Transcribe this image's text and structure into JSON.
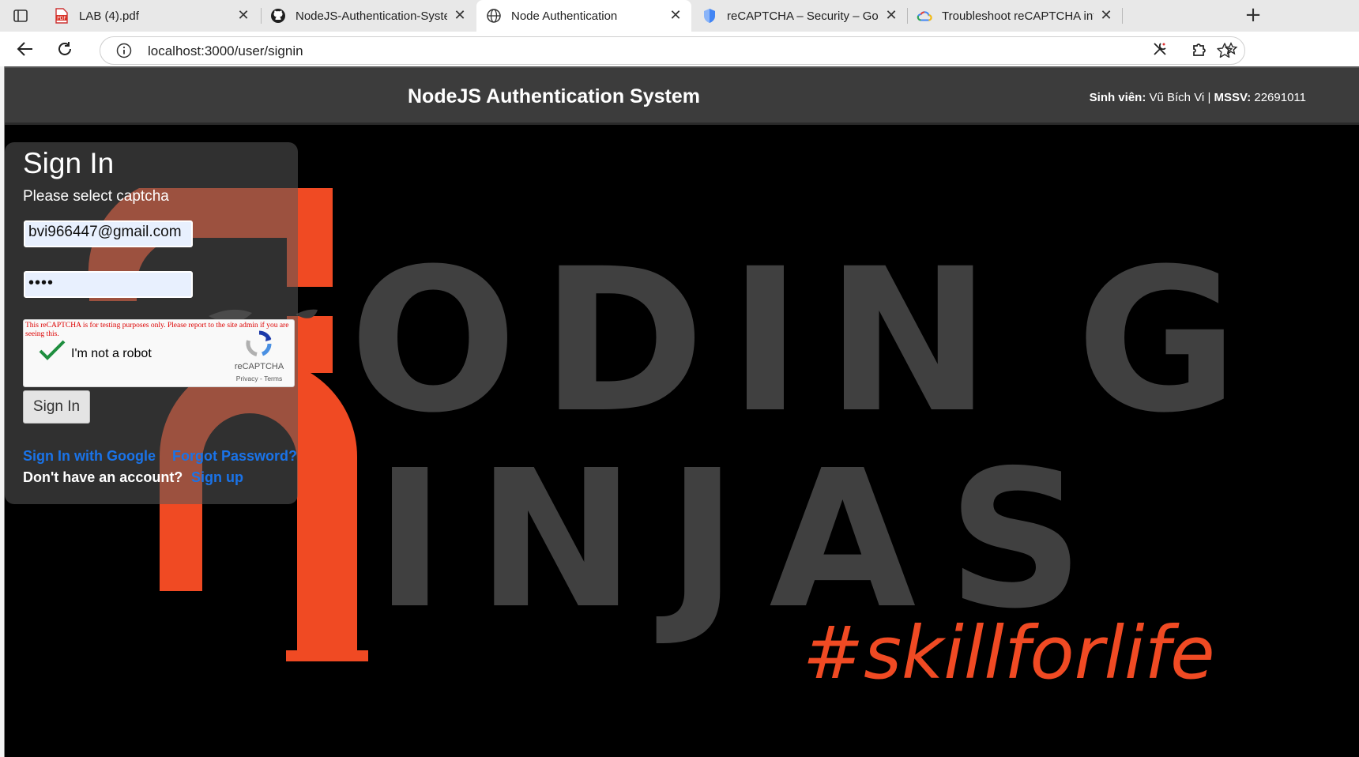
{
  "browser": {
    "tabs": [
      {
        "title": "LAB (4).pdf",
        "icon": "pdf-icon",
        "active": false
      },
      {
        "title": "NodeJS-Authentication-System/p",
        "icon": "github-icon",
        "active": false
      },
      {
        "title": "Node Authentication",
        "icon": "globe-icon",
        "active": true
      },
      {
        "title": "reCAPTCHA – Security – Google C",
        "icon": "shield-icon",
        "active": false
      },
      {
        "title": "Troubleshoot reCAPTCHA integra",
        "icon": "google-cloud-icon",
        "active": false
      }
    ],
    "close_glyph": "✕",
    "new_tab_glyph": "+",
    "url": "localhost:3000/user/signin"
  },
  "header": {
    "title": "NodeJS Authentication System",
    "student_label": "Sinh viên:",
    "student_name": "Vũ Bích Vi",
    "separator": "|",
    "id_label": "MSSV:",
    "id_value": "22691011"
  },
  "signin": {
    "title": "Sign In",
    "message": "Please select captcha",
    "email_value": "bvi966447@gmail.com",
    "password_value": "••••",
    "recaptcha": {
      "warning": "This reCAPTCHA is for testing purposes only. Please report to the site admin if you are seeing this.",
      "label": "I'm not a robot",
      "checked": true,
      "brand": "reCAPTCHA",
      "links": "Privacy - Terms"
    },
    "button_label": "Sign In",
    "google_link": "Sign In with Google",
    "forgot_link": "Forgot Password?",
    "no_account_text": "Don't have an account?",
    "signup_link": "Sign up"
  },
  "background": {
    "line1": "ODIN",
    "line1_tail": "G",
    "line2": "INJAS",
    "tagline": "#skillforlife",
    "colors": {
      "gray": "#404040",
      "orange": "#f04a23",
      "link": "#1a73e8"
    }
  }
}
